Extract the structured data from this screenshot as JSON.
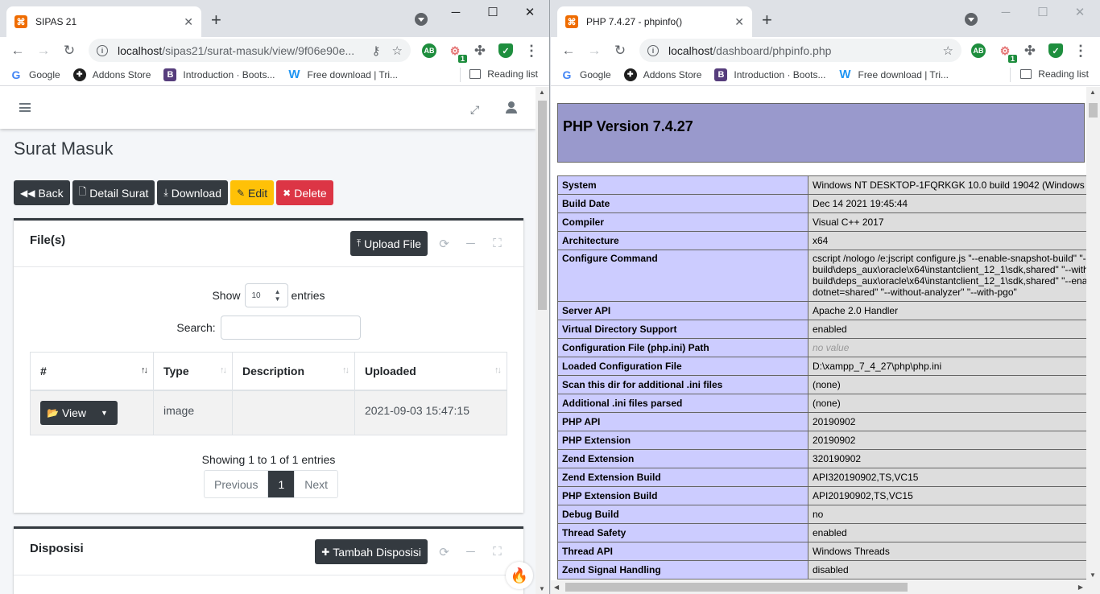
{
  "left": {
    "tab_title": "SIPAS 21",
    "favicon": "⌘",
    "url_host": "localhost",
    "url_path": "/sipas21/surat-masuk/view/9f06e90e...",
    "page_title": "Surat Masuk",
    "buttons": {
      "back": "Back",
      "detail": "Detail Surat",
      "download": "Download",
      "edit": "Edit",
      "delete": "Delete"
    },
    "files_card": {
      "title": "File(s)",
      "upload_label": "Upload File",
      "show_label": "Show",
      "entries_label": "entries",
      "length_value": "10",
      "search_label": "Search:",
      "search_value": "",
      "columns": [
        "#",
        "Type",
        "Description",
        "Uploaded"
      ],
      "rows": [
        {
          "action": "View",
          "type": "image",
          "description": "",
          "uploaded": "2021-09-03 15:47:15"
        }
      ],
      "info": "Showing 1 to 1 of 1 entries",
      "pager": {
        "previous": "Previous",
        "current": "1",
        "next": "Next"
      }
    },
    "dispo_card": {
      "title": "Disposisi",
      "add_label": "Tambah Disposisi"
    }
  },
  "right": {
    "tab_title": "PHP 7.4.27 - phpinfo()",
    "url_host": "localhost",
    "url_path": "/dashboard/phpinfo.php",
    "php_title": "PHP Version 7.4.27",
    "rows": [
      [
        "System",
        "Windows NT DESKTOP-1FQRKGK 10.0 build 19042 (Windows"
      ],
      [
        "Build Date",
        "Dec 14 2021 19:45:44"
      ],
      [
        "Compiler",
        "Visual C++ 2017"
      ],
      [
        "Architecture",
        "x64"
      ],
      [
        "Configure Command",
        "cscript /nologo /e:jscript configure.js \"--enable-snapshot-build\" \"--",
        "build\\deps_aux\\oracle\\x64\\instantclient_12_1\\sdk,shared\" \"--with",
        "build\\deps_aux\\oracle\\x64\\instantclient_12_1\\sdk,shared\" \"--ena",
        "dotnet=shared\" \"--without-analyzer\" \"--with-pgo\""
      ],
      [
        "Server API",
        "Apache 2.0 Handler"
      ],
      [
        "Virtual Directory Support",
        "enabled"
      ],
      [
        "Configuration File (php.ini) Path",
        "no value"
      ],
      [
        "Loaded Configuration File",
        "D:\\xampp_7_4_27\\php\\php.ini"
      ],
      [
        "Scan this dir for additional .ini files",
        "(none)"
      ],
      [
        "Additional .ini files parsed",
        "(none)"
      ],
      [
        "PHP API",
        "20190902"
      ],
      [
        "PHP Extension",
        "20190902"
      ],
      [
        "Zend Extension",
        "320190902"
      ],
      [
        "Zend Extension Build",
        "API320190902,TS,VC15"
      ],
      [
        "PHP Extension Build",
        "API20190902,TS,VC15"
      ],
      [
        "Debug Build",
        "no"
      ],
      [
        "Thread Safety",
        "enabled"
      ],
      [
        "Thread API",
        "Windows Threads"
      ],
      [
        "Zend Signal Handling",
        "disabled"
      ]
    ]
  },
  "bookmarks": [
    {
      "label": "Google",
      "icon": "google-icon"
    },
    {
      "label": "Addons Store",
      "icon": "addons-icon"
    },
    {
      "label": "Introduction · Boots...",
      "icon": "bootstrap-icon"
    },
    {
      "label": "Free download | Tri...",
      "icon": "w-icon"
    }
  ],
  "reading_list": "Reading list",
  "colors": {
    "dark": "#343a40",
    "warning": "#ffc107",
    "danger": "#dc3545",
    "php_header": "#9999cc",
    "php_key": "#ccccff",
    "php_value": "#dddddd"
  }
}
